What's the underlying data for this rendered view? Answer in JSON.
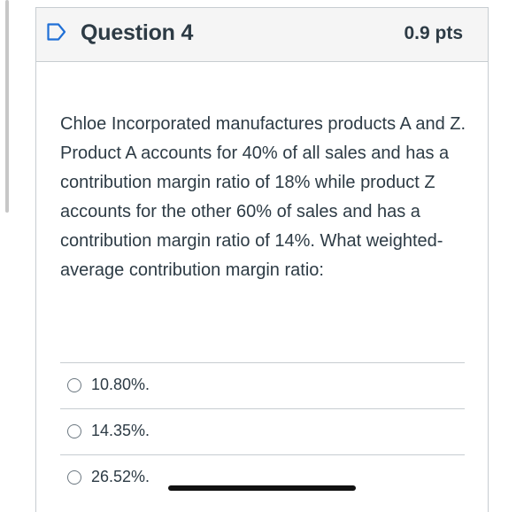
{
  "question": {
    "title": "Question 4",
    "points": "0.9 pts",
    "body": "Chloe Incorporated manufactures products A and Z. Product A accounts for 40% of all sales and has a contribution margin ratio of 18% while product Z accounts for the other 60% of sales and has a contribution margin ratio of 14%. What weighted-average contribution margin ratio:"
  },
  "answers": [
    {
      "label": "10.80%."
    },
    {
      "label": "14.35%."
    },
    {
      "label": "26.52%."
    }
  ],
  "colors": {
    "text": "#2d3b45",
    "flag_accent": "#1f6fd6",
    "header_bg": "#f5f5f5",
    "border": "#c7cdd1"
  },
  "icons": {
    "flag": "flag-question-icon",
    "radio": "radio-unselected-icon"
  }
}
